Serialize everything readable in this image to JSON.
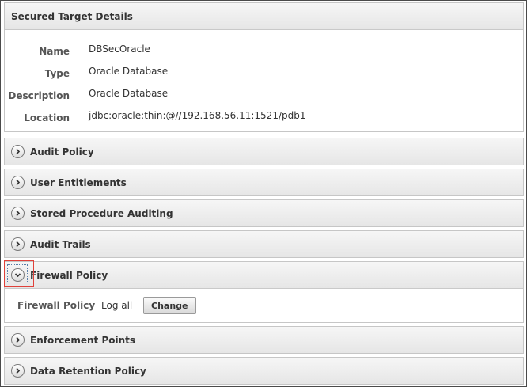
{
  "details": {
    "title": "Secured Target Details",
    "rows": [
      {
        "label": "Name",
        "value": "DBSecOracle"
      },
      {
        "label": "Type",
        "value": "Oracle Database"
      },
      {
        "label": "Description",
        "value": "Oracle Database"
      },
      {
        "label": "Location",
        "value": "jdbc:oracle:thin:@//192.168.56.11:1521/pdb1"
      }
    ]
  },
  "sections": {
    "audit_policy": {
      "label": "Audit Policy",
      "icon": "chevron-right-icon",
      "expanded": false
    },
    "user_entitlements": {
      "label": "User Entitlements",
      "icon": "chevron-right-icon",
      "expanded": false
    },
    "stored_procedure_auditing": {
      "label": "Stored Procedure Auditing",
      "icon": "chevron-right-icon",
      "expanded": false
    },
    "audit_trails": {
      "label": "Audit Trails",
      "icon": "chevron-right-icon",
      "expanded": false
    },
    "firewall_policy": {
      "label": "Firewall Policy",
      "icon": "chevron-down-icon",
      "expanded": true,
      "field_label": "Firewall Policy",
      "field_value": "Log all",
      "change_label": "Change"
    },
    "enforcement_points": {
      "label": "Enforcement Points",
      "icon": "chevron-right-icon",
      "expanded": false
    },
    "data_retention_policy": {
      "label": "Data Retention Policy",
      "icon": "chevron-right-icon",
      "expanded": false
    }
  },
  "colors": {
    "highlight_box": "#e0413a",
    "header_gradient_top": "#f6f6f6",
    "header_gradient_bottom": "#e6e6e6"
  }
}
